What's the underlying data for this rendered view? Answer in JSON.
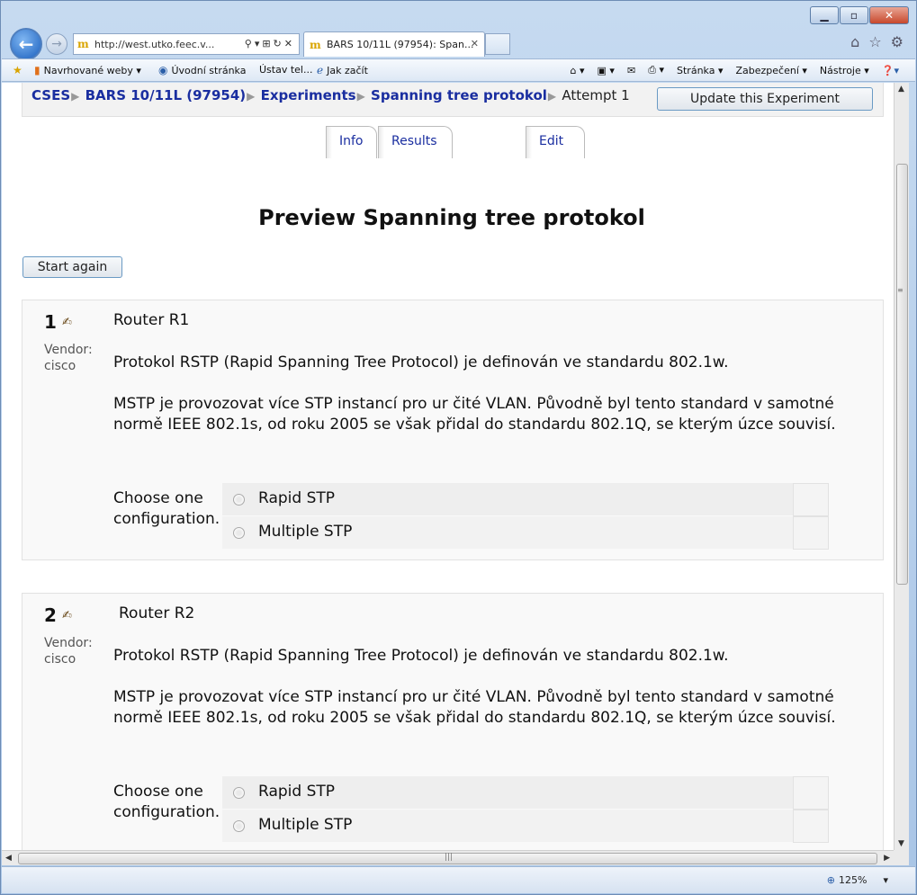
{
  "browser": {
    "address_url": "http://west.utko.feec.v...",
    "tab_title": "BARS 10/11L (97954): Span...",
    "tab_close": "✕",
    "favorites": [
      {
        "label": "Navrhované weby ▾"
      },
      {
        "label": "Úvodní stránka"
      },
      {
        "label": "Ústav tel..."
      },
      {
        "label": "Jak začít"
      }
    ],
    "menus": [
      "Stránka ▾",
      "Zabezpečení ▾",
      "Nástroje ▾"
    ],
    "zoom_level": "125%"
  },
  "breadcrumb": {
    "items": [
      "CSES",
      "BARS 10/11L (97954)",
      "Experiments",
      "Spanning tree protokol"
    ],
    "current": "Attempt 1"
  },
  "update_button": "Update this Experiment",
  "tabs": [
    {
      "label": "Info"
    },
    {
      "label": "Results"
    },
    {
      "label": "Edit"
    }
  ],
  "page_title": "Preview Spanning tree protokol",
  "start_again": "Start again",
  "questions": [
    {
      "number": "1",
      "vendor": "Vendor:\ncisco",
      "title": "Router R1",
      "para1": "Protokol RSTP (Rapid Spanning Tree Protocol) je definován ve standardu 802.1w.",
      "para2": "MSTP je provozovat více STP instancí pro ur čité VLAN. Původně byl tento standard v samotné normě IEEE 802.1s, od roku 2005 se však přidal do standardu 802.1Q, se kterým úzce souvisí.",
      "prompt": "Choose one configuration.",
      "options": [
        "Rapid STP",
        "Multiple STP"
      ]
    },
    {
      "number": "2",
      "vendor": "Vendor:\ncisco",
      "title": "Router R2",
      "para1": "Protokol RSTP (Rapid Spanning Tree Protocol) je definován ve standardu 802.1w.",
      "para2": "MSTP je provozovat více STP instancí pro ur čité VLAN. Původně byl tento standard v samotné normě IEEE 802.1s, od roku 2005 se však přidal do standardu 802.1Q, se kterým úzce souvisí.",
      "prompt": "Choose one configuration.",
      "options": [
        "Rapid STP",
        "Multiple STP"
      ]
    }
  ]
}
